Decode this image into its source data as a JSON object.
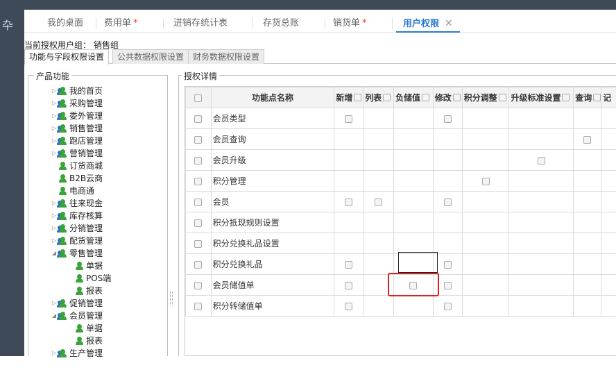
{
  "tabs": [
    {
      "label": "我的桌面",
      "starred": false,
      "active": false
    },
    {
      "label": "费用单",
      "starred": true,
      "active": false
    },
    {
      "label": "进销存统计表",
      "starred": false,
      "active": false
    },
    {
      "label": "存货总账",
      "starred": false,
      "active": false
    },
    {
      "label": "销货单",
      "starred": true,
      "active": false
    },
    {
      "label": "用户权限",
      "starred": false,
      "active": true
    }
  ],
  "tab_star": "*",
  "tab_close": "✕",
  "group": {
    "label": "当前授权用户组：",
    "value": "销售组"
  },
  "subtabs": [
    "功能与字段权限设置",
    "公共数据权限设置",
    "财务数据权限设置"
  ],
  "left_panel": {
    "title": "产品功能",
    "items": [
      {
        "label": "我的首页",
        "arrow": "▷",
        "icon": "multi",
        "level": 0
      },
      {
        "label": "采购管理",
        "arrow": "▷",
        "icon": "multi",
        "level": 0
      },
      {
        "label": "委外管理",
        "arrow": "▷",
        "icon": "multi",
        "level": 0
      },
      {
        "label": "销售管理",
        "arrow": "▷",
        "icon": "multi",
        "level": 0
      },
      {
        "label": "跑店管理",
        "arrow": "▷",
        "icon": "multi",
        "level": 0
      },
      {
        "label": "营销管理",
        "arrow": "▷",
        "icon": "multi",
        "level": 0
      },
      {
        "label": "订货商城",
        "arrow": "",
        "icon": "single",
        "level": 0
      },
      {
        "label": "B2B云商",
        "arrow": "",
        "icon": "single",
        "level": 0
      },
      {
        "label": "电商通",
        "arrow": "",
        "icon": "single",
        "level": 0
      },
      {
        "label": "往来现金",
        "arrow": "▷",
        "icon": "multi",
        "level": 0
      },
      {
        "label": "库存核算",
        "arrow": "▷",
        "icon": "multi",
        "level": 0
      },
      {
        "label": "分销管理",
        "arrow": "▷",
        "icon": "multi",
        "level": 0
      },
      {
        "label": "配货管理",
        "arrow": "▷",
        "icon": "multi",
        "level": 0
      },
      {
        "label": "零售管理",
        "arrow": "◢",
        "icon": "multi",
        "level": 0
      },
      {
        "label": "单据",
        "arrow": "",
        "icon": "single",
        "level": 1
      },
      {
        "label": "POS端",
        "arrow": "",
        "icon": "single",
        "level": 1
      },
      {
        "label": "报表",
        "arrow": "",
        "icon": "single",
        "level": 1
      },
      {
        "label": "促销管理",
        "arrow": "▷",
        "icon": "multi",
        "level": 0
      },
      {
        "label": "会员管理",
        "arrow": "◢",
        "icon": "multi",
        "level": 0
      },
      {
        "label": "单据",
        "arrow": "",
        "icon": "single",
        "level": 1
      },
      {
        "label": "报表",
        "arrow": "",
        "icon": "single",
        "level": 1
      },
      {
        "label": "生产管理",
        "arrow": "▷",
        "icon": "multi",
        "level": 0
      }
    ]
  },
  "right_panel": {
    "title": "授权详情",
    "columns": [
      "功能点名称",
      "新增",
      "列表",
      "负储值",
      "修改",
      "积分调整",
      "升级标准设置",
      "查询",
      "记"
    ],
    "rows": [
      {
        "name": "会员类型",
        "checks": [
          true,
          false,
          false,
          true,
          false,
          false,
          false,
          false
        ]
      },
      {
        "name": "会员查询",
        "checks": [
          false,
          false,
          false,
          false,
          false,
          false,
          true,
          false
        ]
      },
      {
        "name": "会员升级",
        "checks": [
          false,
          false,
          false,
          false,
          false,
          true,
          false,
          false
        ]
      },
      {
        "name": "积分管理",
        "checks": [
          false,
          false,
          false,
          false,
          true,
          false,
          false,
          false
        ]
      },
      {
        "name": "会员",
        "checks": [
          true,
          true,
          false,
          true,
          false,
          false,
          false,
          false
        ]
      },
      {
        "name": "积分抵现规则设置",
        "checks": [
          false,
          false,
          false,
          false,
          false,
          false,
          false,
          false
        ]
      },
      {
        "name": "积分兑换礼品设置",
        "checks": [
          false,
          false,
          false,
          false,
          false,
          false,
          false,
          false
        ]
      },
      {
        "name": "积分兑换礼品",
        "checks": [
          true,
          false,
          false,
          true,
          false,
          false,
          false,
          false
        ]
      },
      {
        "name": "会员储值单",
        "checks": [
          true,
          false,
          true,
          true,
          false,
          false,
          false,
          false
        ]
      },
      {
        "name": "积分转储值单",
        "checks": [
          true,
          false,
          false,
          true,
          false,
          false,
          false,
          false
        ]
      }
    ]
  }
}
